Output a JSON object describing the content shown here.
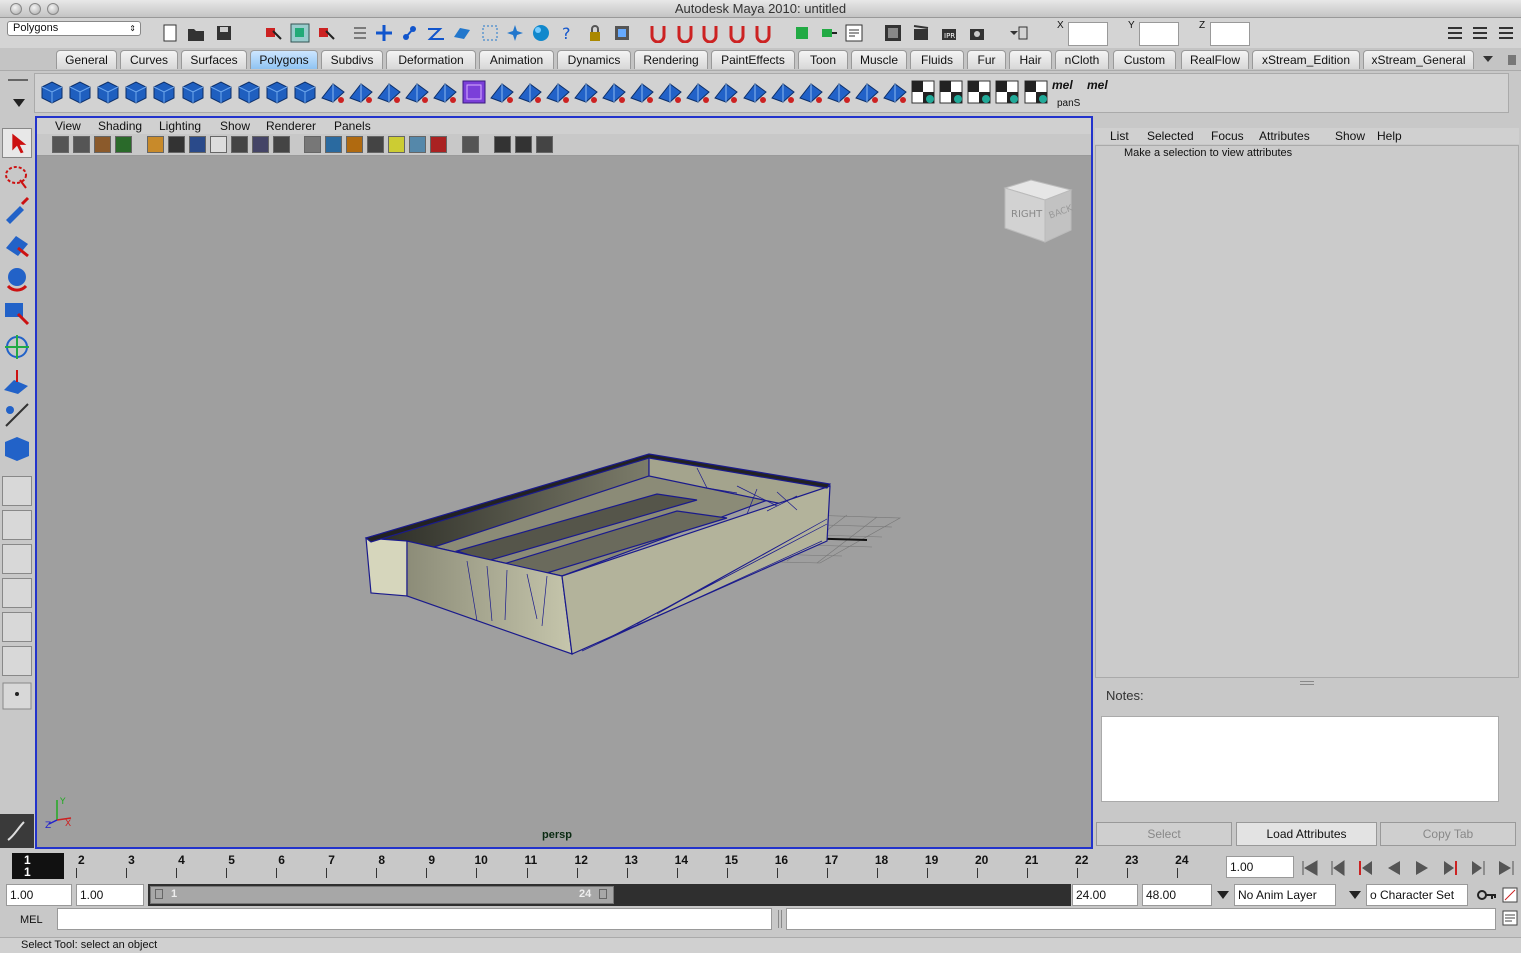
{
  "window": {
    "title": "Autodesk Maya 2010: untitled"
  },
  "status_line": {
    "menu_set": "Polygons",
    "xyz_labels": [
      "X",
      "Y",
      "Z"
    ]
  },
  "shelf_tabs": [
    "General",
    "Curves",
    "Surfaces",
    "Polygons",
    "Subdivs",
    "Deformation",
    "Animation",
    "Dynamics",
    "Rendering",
    "PaintEffects",
    "Toon",
    "Muscle",
    "Fluids",
    "Fur",
    "Hair",
    "nCloth",
    "Custom",
    "RealFlow",
    "xStream_Edition",
    "xStream_General"
  ],
  "active_shelf_tab": "Polygons",
  "shelf": {
    "mel1": "mel",
    "mel2": "mel",
    "mel_caption": "panS"
  },
  "viewport": {
    "menu": [
      "View",
      "Shading",
      "Lighting",
      "Show",
      "Renderer",
      "Panels"
    ],
    "camera_label": "persp",
    "viewcube": {
      "right": "RIGHT",
      "back": "BACK"
    },
    "axis": {
      "x": "X",
      "y": "Y",
      "z": "Z"
    },
    "background": "#9f9f9f",
    "mesh_color": "#1a1a8c"
  },
  "attribute_editor": {
    "menu": [
      "List",
      "Selected",
      "Focus",
      "Attributes",
      "Show",
      "Help"
    ],
    "message": "Make a selection to view attributes",
    "notes_label": "Notes:",
    "buttons": {
      "select": "Select",
      "load": "Load Attributes",
      "copy": "Copy Tab"
    }
  },
  "time_slider": {
    "current_frame": "1",
    "ticks": [
      "1",
      "2",
      "3",
      "4",
      "5",
      "6",
      "7",
      "8",
      "9",
      "10",
      "11",
      "12",
      "13",
      "14",
      "15",
      "16",
      "17",
      "18",
      "19",
      "20",
      "21",
      "22",
      "23",
      "24"
    ],
    "current_time_field": "1.00"
  },
  "range_slider": {
    "start_time": "1.00",
    "playback_start": "1.00",
    "range_start_label": "1",
    "range_end_label": "24",
    "playback_end": "24.00",
    "end_time": "48.00",
    "anim_layer": "No Anim Layer",
    "character_set": "o Character Set"
  },
  "command_line": {
    "label": "MEL"
  },
  "help_line": {
    "text": "Select Tool: select an object"
  }
}
